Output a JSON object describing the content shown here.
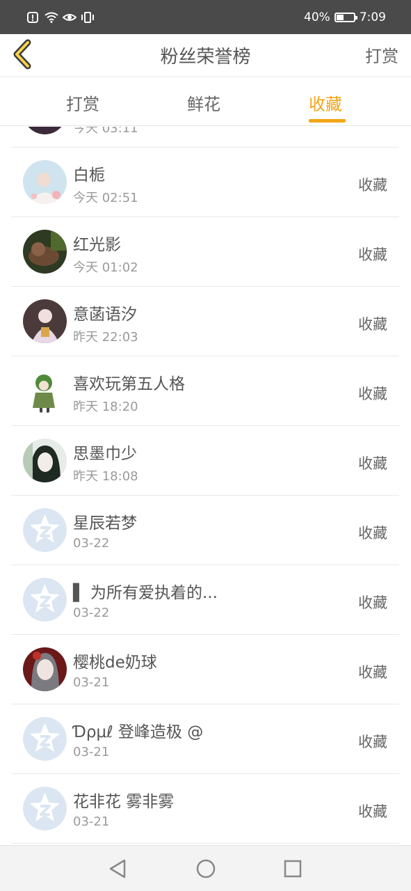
{
  "status_bar": {
    "battery": "40%",
    "time": "7:09",
    "battery_level": 0.4,
    "icons": [
      "alert-icon",
      "wifi-icon",
      "eye-icon",
      "vibrate-icon"
    ]
  },
  "header": {
    "title": "粉丝荣誉榜",
    "right_label": "打赏",
    "back_icon": "chevron-left-icon",
    "accent": "#f2a618"
  },
  "tabs": [
    {
      "label": "打赏",
      "active": false
    },
    {
      "label": "鲜花",
      "active": false
    },
    {
      "label": "收藏",
      "active": true
    }
  ],
  "list": {
    "partial_top_time": "今天 03:11",
    "rows": [
      {
        "name": "白栀",
        "time": "今天 02:51",
        "action": "收藏",
        "avatar": "photo-avatar"
      },
      {
        "name": "红光影",
        "time": "今天 01:02",
        "action": "收藏",
        "avatar": "photo-avatar"
      },
      {
        "name": "意菡语汐",
        "time": "昨天 22:03",
        "action": "收藏",
        "avatar": "photo-avatar"
      },
      {
        "name": "喜欢玩第五人格",
        "time": "昨天 18:20",
        "action": "收藏",
        "avatar": "photo-avatar"
      },
      {
        "name": "思墨巾少",
        "time": "昨天 18:08",
        "action": "收藏",
        "avatar": "photo-avatar"
      },
      {
        "name": "星辰若梦",
        "time": "03-22",
        "action": "收藏",
        "avatar": "default-avatar"
      },
      {
        "name": "▌ 为所有爱执着的...",
        "time": "03-22",
        "action": "收藏",
        "avatar": "default-avatar"
      },
      {
        "name": "樱桃de奶球",
        "time": "03-21",
        "action": "收藏",
        "avatar": "photo-avatar"
      },
      {
        "name": "Ɗρμℓ 登峰造极 @",
        "time": "03-21",
        "action": "收藏",
        "avatar": "default-avatar"
      },
      {
        "name": "花非花 雾非雾",
        "time": "03-21",
        "action": "收藏",
        "avatar": "default-avatar"
      }
    ]
  },
  "nav": {
    "back_icon": "nav-back-icon",
    "home_icon": "nav-home-icon",
    "recents_icon": "nav-recents-icon"
  }
}
